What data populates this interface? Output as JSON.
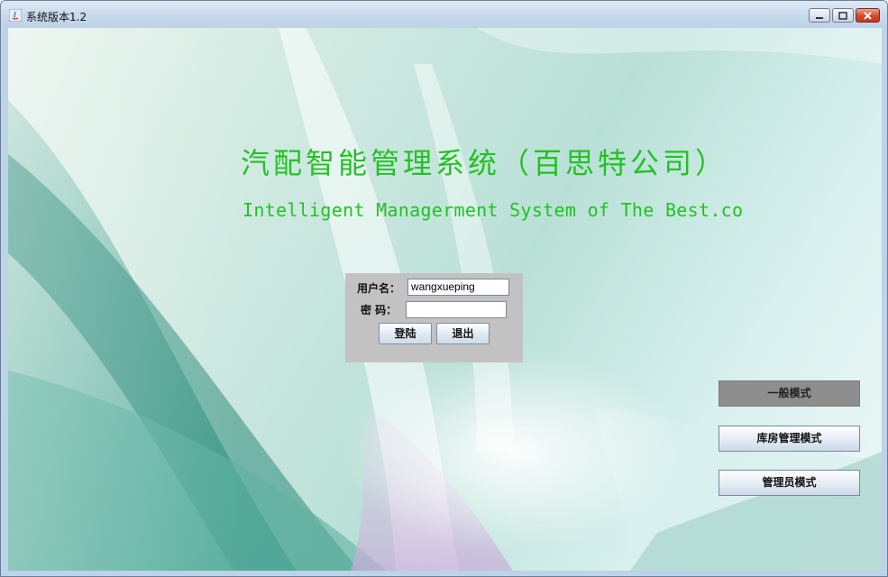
{
  "window": {
    "title": "系统版本1.2",
    "controls": [
      "minimize-icon",
      "maximize-icon",
      "close-icon"
    ]
  },
  "header": {
    "title_cn": "汽配智能管理系统（百思特公司）",
    "title_en": "Intelligent Managerment System of The Best.co"
  },
  "login": {
    "username_label": "用户名：",
    "username_value": "wangxueping",
    "password_label": "密 码：",
    "password_value": "",
    "login_button": "登陆",
    "exit_button": "退出"
  },
  "modes": {
    "items": [
      {
        "label": "一般模式",
        "selected": true
      },
      {
        "label": "库房管理模式",
        "selected": false
      },
      {
        "label": "管理员模式",
        "selected": false
      }
    ]
  },
  "colors": {
    "title_green": "#22c222",
    "panel_gray": "#c2c2c2",
    "selected_gray": "#8e8e8e"
  }
}
